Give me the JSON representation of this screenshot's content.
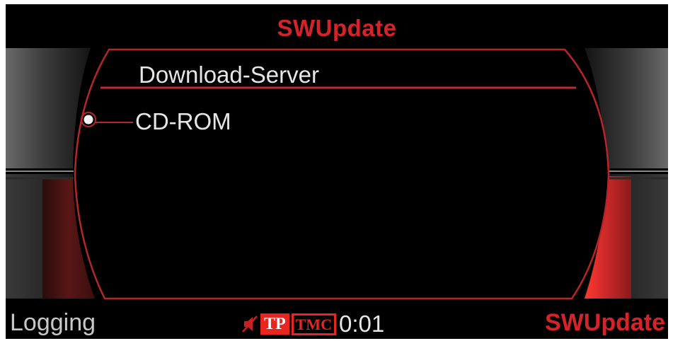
{
  "header": {
    "title": "SWUpdate"
  },
  "menu": {
    "items": [
      {
        "label": "Download-Server",
        "selected": true
      },
      {
        "label": "CD-ROM",
        "selected": false
      }
    ]
  },
  "softkeys": {
    "left": "Logging",
    "right": "SWUpdate"
  },
  "status": {
    "mute_icon": "speaker-muted-icon",
    "tp_label": "TP",
    "tmc_label": "TMC",
    "time": "0:01"
  },
  "colors": {
    "accent_red": "#d4242a",
    "badge_red": "#e8261f",
    "background": "#000000",
    "text": "#e6e6e6"
  }
}
